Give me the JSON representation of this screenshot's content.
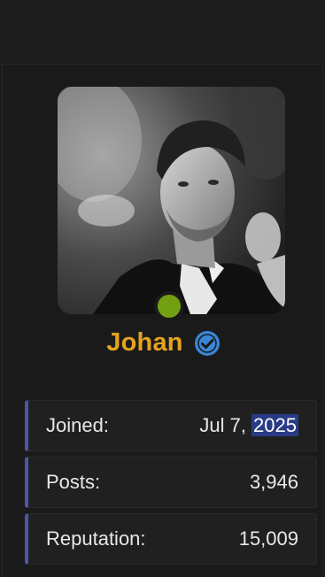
{
  "profile": {
    "username": "Johan",
    "verified_icon": "verified-check-icon",
    "status": "online",
    "status_color": "#73a012",
    "name_color": "#e3a320",
    "accent_color": "#4a56a6"
  },
  "stats": {
    "joined": {
      "label": "Joined:",
      "value_prefix": "Jul 7, ",
      "value_highlight": "2025"
    },
    "posts": {
      "label": "Posts:",
      "value": "3,946"
    },
    "reputation": {
      "label": "Reputation:",
      "value": "15,009"
    }
  }
}
